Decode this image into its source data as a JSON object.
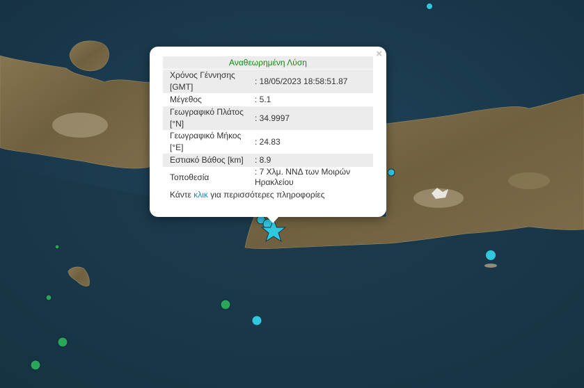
{
  "popup": {
    "title": "Αναθεωρημένη Λύση",
    "close": "×",
    "rows": [
      {
        "label": "Χρόνος Γέννησης [GMT]",
        "value": ": 18/05/2023 18:58:51.87"
      },
      {
        "label": "Μέγεθος",
        "value": ": 5.1"
      },
      {
        "label": "Γεωγραφικό Πλάτος [°N]",
        "value": ": 34.9997"
      },
      {
        "label": "Γεωγραφικό Μήκος [°E]",
        "value": ": 24.83"
      },
      {
        "label": "Εστιακό Βάθος [km]",
        "value": ": 8.9"
      },
      {
        "label": "Τοποθεσία",
        "value": ": 7 Χλμ. ΝΝΔ των Μοιρών Ηρακλείου"
      }
    ],
    "footer_before": "Κάντε ",
    "footer_link": "κλικ",
    "footer_after": " για περισσότερες πληροφορίες"
  },
  "colors": {
    "sea": "#1c3b4e",
    "land": "#7a6a48",
    "marker_cyan": "#30c8e0",
    "marker_green": "#2aa65a",
    "title_green": "#138a13",
    "link": "#1a8ab0"
  }
}
